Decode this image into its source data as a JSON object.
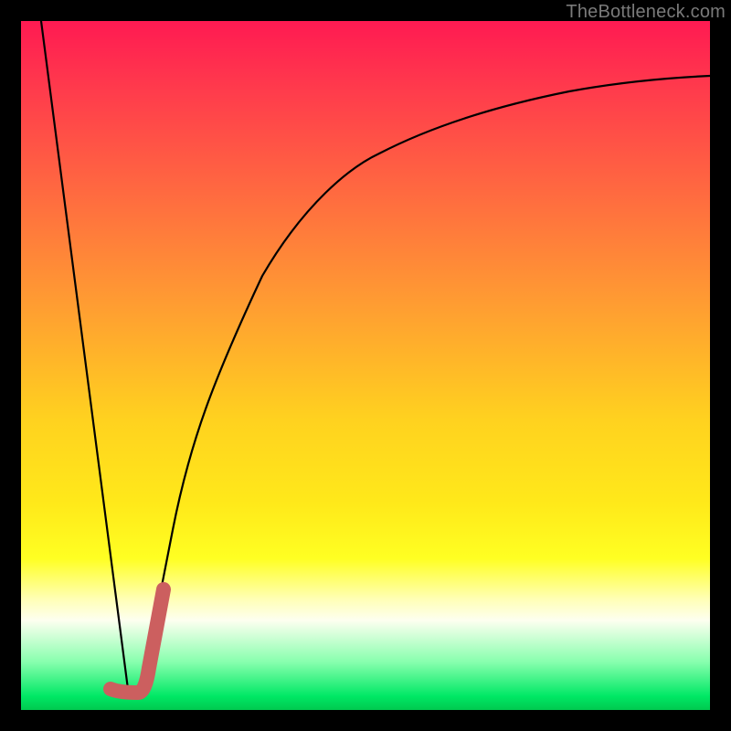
{
  "watermark": "TheBottleneck.com",
  "colors": {
    "curve_main": "#000000",
    "curve_accent": "#cc5f5f",
    "background_frame": "#000000"
  },
  "chart_data": {
    "type": "line",
    "title": "",
    "xlabel": "",
    "ylabel": "",
    "xlim": [
      0,
      1
    ],
    "ylim": [
      0,
      1
    ],
    "grid": false,
    "legend": false,
    "background": "red-yellow-green vertical gradient",
    "series": [
      {
        "name": "left-descending-line",
        "color": "#000000",
        "x": [
          0.03,
          0.155
        ],
        "y": [
          1.0,
          0.03
        ]
      },
      {
        "name": "right-ascending-curve",
        "color": "#000000",
        "x": [
          0.175,
          0.22,
          0.28,
          0.35,
          0.43,
          0.52,
          0.62,
          0.74,
          0.86,
          1.0
        ],
        "y": [
          0.03,
          0.26,
          0.48,
          0.63,
          0.73,
          0.8,
          0.85,
          0.88,
          0.905,
          0.92
        ]
      },
      {
        "name": "accent-j-stroke",
        "color": "#cc5f5f",
        "x": [
          0.13,
          0.148,
          0.17,
          0.186,
          0.207
        ],
        "y": [
          0.03,
          0.025,
          0.025,
          0.06,
          0.175
        ]
      }
    ]
  }
}
